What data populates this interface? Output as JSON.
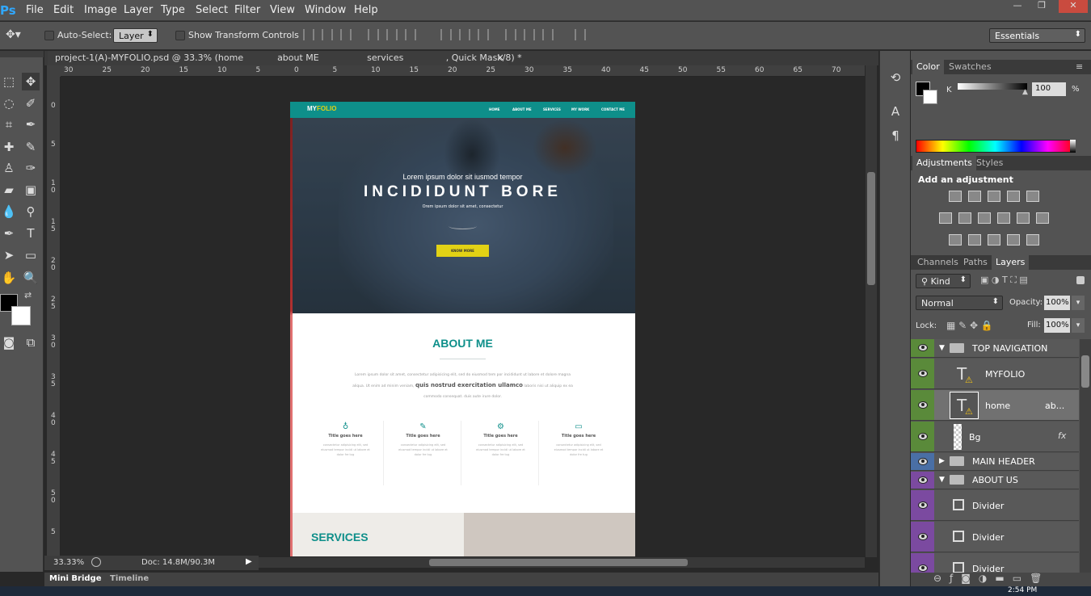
{
  "app": {
    "logo": "Ps"
  },
  "menu": [
    "File",
    "Edit",
    "Image",
    "Layer",
    "Type",
    "Select",
    "Filter",
    "View",
    "Window",
    "Help"
  ],
  "window_controls": [
    "—",
    "❐",
    "✕"
  ],
  "options": {
    "auto_select_label": "Auto-Select:",
    "auto_select_value": "Layer",
    "transform_label": "Show Transform Controls",
    "workspace": "Essentials"
  },
  "document": {
    "tab_title": "project-1(A)-MYFOLIO.psd @ 33.3% (home            about ME                 services               , Quick Mask/8) *",
    "tab_close": "×"
  },
  "rulers": {
    "h": [
      "30",
      "25",
      "20",
      "15",
      "10",
      "5",
      "0",
      "5",
      "10",
      "15",
      "20",
      "25",
      "30",
      "35",
      "40",
      "45",
      "50",
      "55",
      "60",
      "65",
      "70"
    ],
    "v": [
      "0",
      "5",
      "1\n0",
      "1\n5",
      "2\n0",
      "2\n5",
      "3\n0",
      "3\n5",
      "4\n0",
      "4\n5",
      "5\n0",
      "5"
    ]
  },
  "site": {
    "logo_a": "MY",
    "logo_b": "FOLIO",
    "nav": [
      "HOME",
      "ABOUT ME",
      "SERVICES",
      "MY WORK",
      "CONTACT ME"
    ],
    "hero_small": "Lorem ipsum dolor sit iusmod tempor",
    "hero_big": "INCIDIDUNT BORE",
    "hero_sub": "Orem ipsum dolor sit amet, consectetur",
    "hero_button": "KNOW MORE",
    "about_title": "ABOUT ME",
    "about_line1": "Lorem ipsum dolor sit amet, consectetur adipisicing elit, sed do eiusmod tem por incididunt ut labore et dolore magna",
    "about_line2a": "aliqua. Ut enim ad minim veniam,",
    "about_line2b": "quis nostrud exercitation ullamco",
    "about_line2c": "laboris nisi ut aliquip ex ea",
    "about_line3": "commodo consequat. duis aute irure dolor.",
    "features": [
      {
        "icon": "bulb-icon",
        "glyph": "♁",
        "title": "Title goes here",
        "text": "consectetur adipisicing elit, sed eiusmod tempor incidi ut labore et dolor fre tug"
      },
      {
        "icon": "pencil-icon",
        "glyph": "✎",
        "title": "Title goes here",
        "text": "consectetur adipisicing elit, sed eiusmod tempor incidi ut labore et dolor fre tug"
      },
      {
        "icon": "gear-icon",
        "glyph": "⚙",
        "title": "Title goes here",
        "text": "consectetur adipisicing elit, sed eiusmod tempor incidi ut labore et dolor fre tug"
      },
      {
        "icon": "monitor-icon",
        "glyph": "▭",
        "title": "Title goes here",
        "text": "consectetur adipisicing elit, sed eiusmod tempor incidi ut labore et dolor fre tug"
      }
    ],
    "services_title": "SERVICES"
  },
  "status": {
    "zoom": "33.33%",
    "doc": "Doc: 14.8M/90.3M"
  },
  "bottom_tabs": [
    "Mini Bridge",
    "Timeline"
  ],
  "color_panel": {
    "tabs": [
      "Color",
      "Swatches"
    ],
    "channel": "K",
    "value": "100",
    "unit": "%"
  },
  "adjust_panel": {
    "tabs": [
      "Adjustments",
      "Styles"
    ],
    "heading": "Add an adjustment"
  },
  "layers_panel": {
    "tabs": [
      "Channels",
      "Paths",
      "Layers"
    ],
    "kind": "Kind",
    "blend": "Normal",
    "opacity_label": "Opacity:",
    "opacity": "100%",
    "lock_label": "Lock:",
    "fill_label": "Fill:",
    "fill": "100%",
    "layers": [
      {
        "name": "TOP NAVIGATION",
        "kind": "group-open",
        "color": "#5a8a3a"
      },
      {
        "name": "MYFOLIO",
        "kind": "text",
        "color": "#5a8a3a"
      },
      {
        "name": "home",
        "extra": "ab...",
        "kind": "text-selected",
        "color": "#5a8a3a"
      },
      {
        "name": "Bg",
        "kind": "pixel",
        "color": "#5a8a3a"
      },
      {
        "name": "MAIN HEADER",
        "kind": "group-closed",
        "color": "#4a6fa5"
      },
      {
        "name": "ABOUT US",
        "kind": "group-open",
        "color": "#7b4aa0"
      },
      {
        "name": "Divider",
        "kind": "smart",
        "color": "#7b4aa0"
      },
      {
        "name": "Divider",
        "kind": "smart",
        "color": "#7b4aa0"
      },
      {
        "name": "Divider",
        "kind": "smart",
        "color": "#7b4aa0"
      }
    ]
  },
  "clock": "2:54 PM",
  "colors": {
    "teal": "#0e8f8a",
    "yellow": "#e2d215",
    "panel": "#535353"
  }
}
